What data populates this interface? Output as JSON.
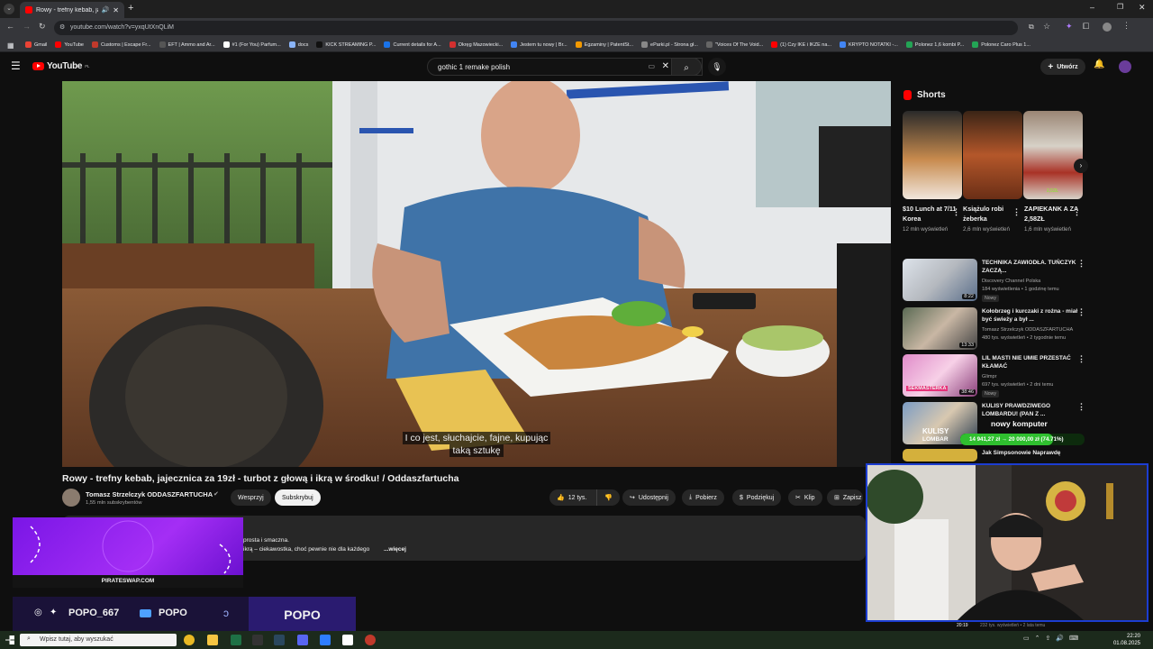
{
  "browser": {
    "tab_title": "Rowy - trefny kebab, jajeczn",
    "url": "youtube.com/watch?v=yxqUtXnQLiM",
    "bookmarks": [
      {
        "label": "Gmail",
        "color": "#ea4335"
      },
      {
        "label": "YouTube",
        "color": "#ff0000"
      },
      {
        "label": "Customs | Escape Fr...",
        "color": "#c0392b"
      },
      {
        "label": "EFT | Ammo and Ar...",
        "color": "#555555"
      },
      {
        "label": "#1 (For You) Parfum...",
        "color": "#ffffff"
      },
      {
        "label": "docs",
        "color": "#8ab4f8"
      },
      {
        "label": "KICK STREAMING P...",
        "color": "#111111"
      },
      {
        "label": "Current details for A...",
        "color": "#1a73e8"
      },
      {
        "label": "Okręg Mazowiecki...",
        "color": "#d32f2f"
      },
      {
        "label": "Jestem tu nowy | Br...",
        "color": "#4285f4"
      },
      {
        "label": "Egzaminy | PatentSt...",
        "color": "#f29900"
      },
      {
        "label": "eParki.pl - Strona gł...",
        "color": "#888888"
      },
      {
        "label": "\"Voices Of The Void...",
        "color": "#666666"
      },
      {
        "label": "(1) Czy IKE i IKZE na...",
        "color": "#ff0000"
      },
      {
        "label": "KRYPTO NOTATKI -...",
        "color": "#4285f4"
      },
      {
        "label": "Polonez 1,6 kombi P...",
        "color": "#23a455"
      },
      {
        "label": "Polonez Caro Plus 1...",
        "color": "#23a455"
      }
    ]
  },
  "youtube": {
    "logo": "YouTube",
    "logo_region": "PL",
    "search_value": "gothic 1 remake polish",
    "create_label": "Utwórz"
  },
  "video": {
    "subtitle_line1": "I co jest, słuchajcie, fajne, kupując",
    "subtitle_line2": "taką sztukę",
    "title": "Rowy - trefny kebab, jajecznica za 19zł - turbot z głową i ikrą w środku! / Oddaszfartucha",
    "channel_name": "Tomasz Strzelczyk ODDASZFARTUCHA",
    "subscribers": "1,55 mln subskrybentów",
    "join_label": "Wesprzyj",
    "subscribe_label": "Subskrybuj",
    "likes": "12 tys.",
    "share_label": "Udostępnij",
    "download_label": "Pobierz",
    "thanks_label": "Podziękuj",
    "clip_label": "Klip",
    "save_label": "Zapisz",
    "desc_line1": "prosta i smaczna.",
    "desc_line2": "ikrą – ciekawostka, choć pewnie nie dla każdego",
    "desc_more": "...więcej"
  },
  "shorts": {
    "heading": "Shorts",
    "items": [
      {
        "title": "$10 Lunch at 7/11 Korea",
        "views": "12 mln wyświetleń"
      },
      {
        "title": "Książulo robi żeberka",
        "views": "2,6 mln wyświetleń"
      },
      {
        "title": "ZAPIEKANK A ZA 2,58ZŁ",
        "views": "1,6 mln wyświetleń",
        "overlay": "2,5ZŁ"
      }
    ]
  },
  "recommended": [
    {
      "title": "TECHNIKA ZAWIODŁA. TUŃCZYK ZACZĄ...",
      "channel": "Discovery Channel Polska",
      "meta": "184 wyświetlenia • 1 godzinę temu",
      "badge": "Nowy",
      "duration": "8:22"
    },
    {
      "title": "Kołobrzeg i kurczaki z rożna - miał być świeży a był ...",
      "channel": "Tomasz Strzelczyk ODDASZFARTUCHA",
      "meta": "480 tys. wyświetleń • 2 tygodnie temu",
      "badge": "",
      "duration": "13:33"
    },
    {
      "title": "LIL MASTI NIE UMIE PRZESTAĆ KŁAMAĆ",
      "channel": "Glimpr",
      "meta": "697 tys. wyświetleń • 2 dni temu",
      "badge": "Nowy",
      "duration": "38:46"
    },
    {
      "title": "KULISY PRAWDZIWEGO LOMBARDU! (PAN Z ...",
      "channel": "",
      "meta": "",
      "badge": "",
      "duration": ""
    },
    {
      "title": "Jak Simpsonowie Naprawdę",
      "channel": "",
      "meta": "",
      "badge": "",
      "duration": ""
    }
  ],
  "stream_overlay": {
    "goal_label": "nowy komputer",
    "goal_progress": "14 941,27 zł → 20 000,00 zł (74.71%)",
    "goal_fraction": 0.7471,
    "thumb_text_1": "SEKMASTERKA",
    "thumb_text_2": "KULISY",
    "thumb_text_3": "LOMBAR",
    "card_site": "PIRATESWAP.COM",
    "social_handle_1": "POPO_667",
    "social_handle_2": "POPO",
    "brand_name": "POPO",
    "bottom_duration": "20:19",
    "bottom_meta": "232 tys. wyświetleń • 2 lata temu"
  },
  "taskbar": {
    "search_placeholder": "Wpisz tutaj, aby wyszukać",
    "time": "22:20",
    "date": "01.08.2025"
  }
}
